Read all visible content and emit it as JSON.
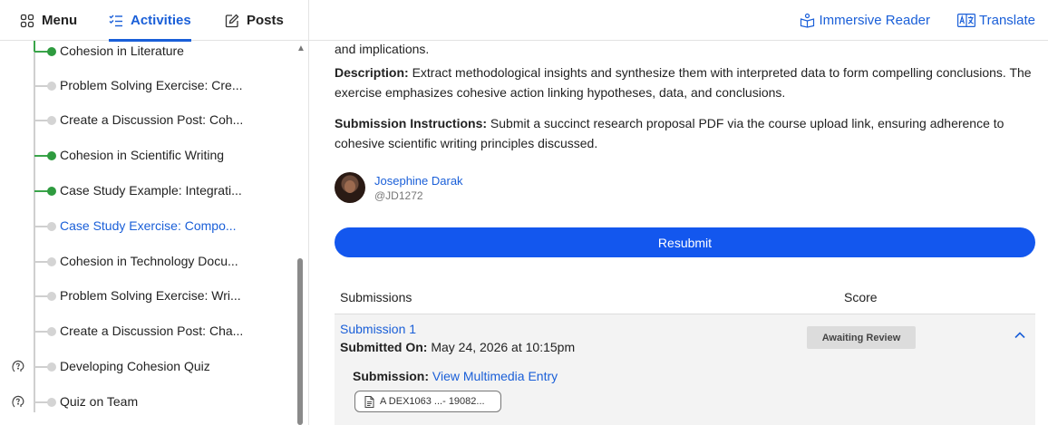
{
  "tabs": {
    "menu": "Menu",
    "activities": "Activities",
    "posts": "Posts"
  },
  "top_actions": {
    "immersive_reader": "Immersive Reader",
    "translate": "Translate"
  },
  "sidebar": {
    "items": [
      {
        "label": "Cohesion in Literature",
        "state": "done"
      },
      {
        "label": "Problem Solving Exercise: Cre...",
        "state": "todo"
      },
      {
        "label": "Create a Discussion Post: Coh...",
        "state": "todo"
      },
      {
        "label": "Cohesion in Scientific Writing",
        "state": "done"
      },
      {
        "label": "Case Study Example: Integrati...",
        "state": "done"
      },
      {
        "label": "Case Study Exercise: Compo...",
        "state": "current"
      },
      {
        "label": "Cohesion in Technology Docu...",
        "state": "todo"
      },
      {
        "label": "Problem Solving Exercise: Wri...",
        "state": "todo"
      },
      {
        "label": "Create a Discussion Post: Cha...",
        "state": "todo"
      },
      {
        "label": "Developing Cohesion Quiz",
        "state": "quiz"
      },
      {
        "label": "Quiz on Team",
        "state": "quiz"
      }
    ]
  },
  "content": {
    "intro_tail": "and implications.",
    "description_label": "Description:",
    "description_text": "Extract methodological insights and synthesize them with interpreted data to form compelling conclusions. The exercise emphasizes cohesive action linking hypotheses, data, and conclusions.",
    "instructions_label": "Submission Instructions:",
    "instructions_text": "Submit a succinct research proposal PDF via the course upload link, ensuring adherence to cohesive scientific writing principles discussed."
  },
  "author": {
    "name": "Josephine Darak",
    "handle": "@JD1272"
  },
  "resubmit_label": "Resubmit",
  "submissions": {
    "col_submissions": "Submissions",
    "col_score": "Score",
    "rows": [
      {
        "title": "Submission 1",
        "submitted_on_label": "Submitted On:",
        "submitted_on_value": "May 24, 2026 at 10:15pm",
        "status": "Awaiting Review",
        "entry_label": "Submission:",
        "entry_link": "View Multimedia Entry",
        "file_name": "A DEX1063 ...- 19082..."
      }
    ]
  },
  "colors": {
    "accent": "#1a5fd8",
    "button": "#1357ee",
    "done": "#2e9b3f"
  }
}
